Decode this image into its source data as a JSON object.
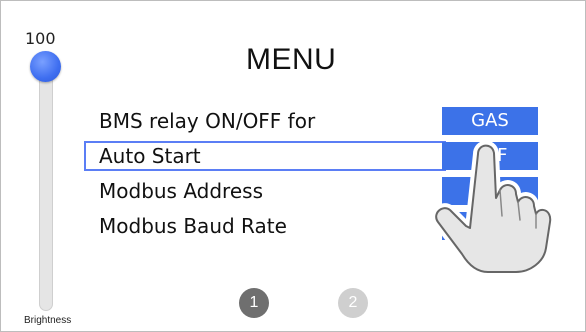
{
  "slider": {
    "value": "100",
    "label": "Brightness",
    "level_percent": 100
  },
  "title": "MENU",
  "menu": {
    "rows": [
      {
        "label": "BMS relay ON/OFF for",
        "value": "GAS"
      },
      {
        "label": "Auto Start",
        "value": "OFF"
      },
      {
        "label": "Modbus Address",
        "value": ""
      },
      {
        "label": "Modbus Baud Rate",
        "value": ""
      }
    ],
    "selected_index": 1
  },
  "pages": {
    "items": [
      "1",
      "2"
    ],
    "current": "1"
  },
  "colors": {
    "accent": "#3c72e8",
    "selection": "#5b7ef5",
    "knob": "#3e6ef0"
  },
  "icons": {
    "pointer": "hand-pointer-icon"
  }
}
